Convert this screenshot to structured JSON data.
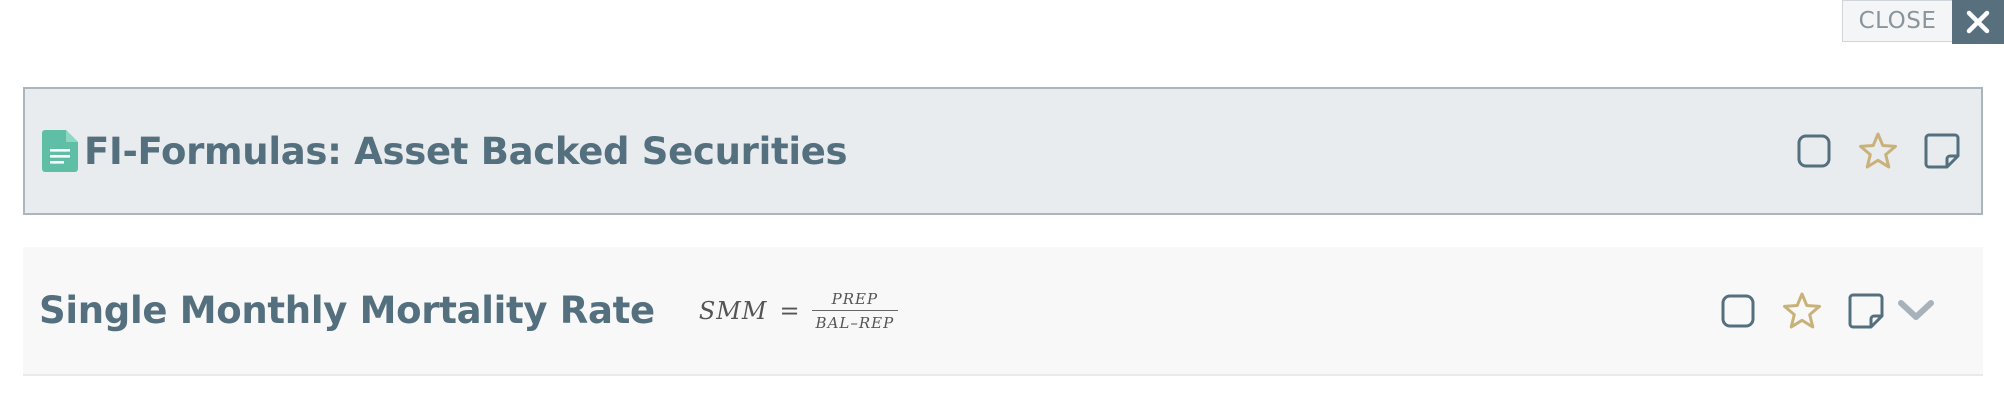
{
  "toolbar": {
    "close_label": "CLOSE"
  },
  "document": {
    "title": "FI-Formulas: Asset Backed Securities",
    "icon": "document-icon"
  },
  "formula_row": {
    "title": "Single Monthly Mortality Rate",
    "formula": {
      "lhs": "SMM",
      "equals": "=",
      "numerator": "PREP",
      "denominator": "BAL–REP"
    }
  },
  "colors": {
    "title": "#546f7e",
    "accent_star": "#c9b27a",
    "doc_icon": "#5fbfa6",
    "close_bg": "#58707e"
  }
}
